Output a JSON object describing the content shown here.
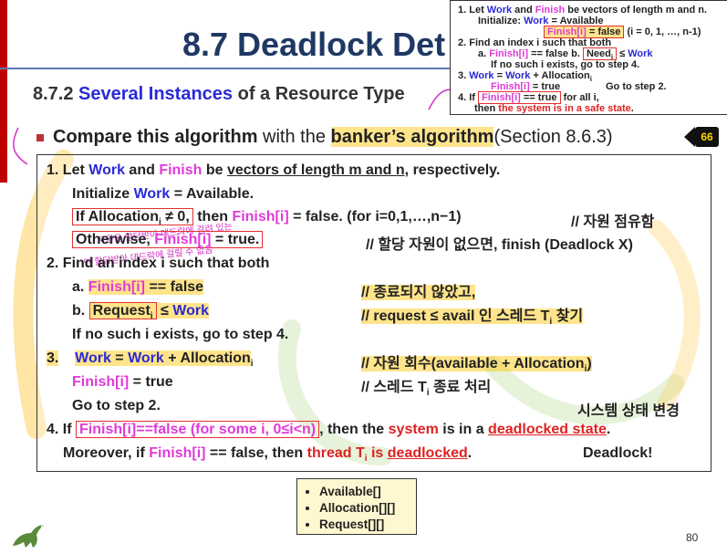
{
  "title": "8.7 Deadlock Det",
  "subtitle": {
    "prefix": "8.7.2 ",
    "highlight": "Several Instances",
    "suffix": " of a Resource Type"
  },
  "bullet": {
    "bold": "Compare this algorithm",
    "middle": " with the ",
    "banker": "banker’s algorithm",
    "section": "(Section 8.6.3)",
    "badge": "66"
  },
  "main": {
    "l1": {
      "num": "1.",
      "a": "Let ",
      "work": "Work",
      "b": " and ",
      "finish": "Finish",
      "c": " be ",
      "d": "vectors of length m and n",
      "e": ", respectively."
    },
    "l2": {
      "a": "Initialize ",
      "work": "Work",
      "b": " = Available."
    },
    "l3": {
      "a": "If  Allocation",
      "sub": "i",
      "b": " ≠ 0,",
      "c": " then ",
      "finish": "Finish[i]",
      "d": " = false.  (for i=0,1,…,n−1)",
      "comment": "// 자원 점유함"
    },
    "l4": {
      "a": "Otherwise, ",
      "finish": "Finish[i]",
      "b": " = true.",
      "comment": "// 할당 자원이 없으면, finish (Deadlock X)"
    },
    "l5": {
      "text": "2. Find an index i such that both"
    },
    "l6": {
      "a": "a.  ",
      "finish": "Finish[i]",
      "b": " == false",
      "comment": "// 종료되지 않았고,"
    },
    "l7": {
      "a": "b.  ",
      "req": "Request",
      "sub": "i",
      "b": " ≤ ",
      "work": "Work",
      "comment": "// request  ≤  avail 인 스레드 T",
      "csub": "i",
      "cend": " 찾기"
    },
    "l8": {
      "text": "If  no such i exists,  go to step 4."
    },
    "l9": {
      "num": "3.",
      "work": "Work",
      "b": " = ",
      "work2": "Work",
      "c": " + Allocation",
      "sub": "i",
      "comment": "// 자원 회수(available + Allocation",
      "csub": "i",
      "cend": ")"
    },
    "l10": {
      "finish": "Finish[i]",
      "b": " = true",
      "comment": "// 스레드 T",
      "csub": "i",
      "cend": " 종료 처리"
    },
    "l11": {
      "text": "Go to step 2.",
      "note": "시스템 상태 변경"
    },
    "l12": {
      "a": "4. If ",
      "finish": "Finish[i]==false (for some i, 0≤i<n)",
      "b": ",  then the ",
      "sys": "system",
      "c": " is in a ",
      "dead": "deadlocked state",
      "d": "."
    },
    "l13": {
      "a": "Moreover, if ",
      "finish": "Finish[i]",
      "b": " == false,  then ",
      "thread": "thread T",
      "tsub": "i",
      "c": " is ",
      "dl": "deadlocked",
      "d": ".",
      "note": "Deadlock!"
    },
    "hand1": "자원을 할당받아 데드락에 걸려 있는",
    "hand2": "안 할당받아 데드락에 걸릴 수 없음"
  },
  "topbox": {
    "t1": {
      "a": "1. Let ",
      "work": "Work",
      "b": " and ",
      "finish": "Finish",
      "c": " be vectors of length m and n."
    },
    "t2": {
      "a": "Initialize:  ",
      "work": "Work",
      "b": " = Available"
    },
    "t3": {
      "finish": "Finish[i]",
      "b": " = false",
      "c": "  (i = 0, 1, …, n-1)"
    },
    "t4": {
      "text": "2. Find an index i such that both"
    },
    "t5": {
      "a": "a. ",
      "finish": "Finish[i]",
      "b": " == false",
      "c": "      b. ",
      "need": "Need",
      "sub": "i",
      "d": " ≤ ",
      "work": "Work"
    },
    "t6": {
      "text": "If no such i exists,  go to step 4."
    },
    "t7": {
      "a": "3. ",
      "work": "Work",
      "b": " = ",
      "work2": "Work",
      "c": " + Allocation",
      "sub": "i"
    },
    "t8": {
      "finish": "Finish[i]",
      "b": " = true",
      "c": "Go to step 2."
    },
    "t9": {
      "a": "4. If ",
      "finish": "Finish[i]",
      "b": " == true",
      "c": "  for all i,"
    },
    "t10": {
      "a": "then ",
      "sys": "the system is in a safe state",
      "b": "."
    }
  },
  "lowbox": [
    "Available[]",
    "Allocation[][]",
    "Request[][]"
  ],
  "page_number": "80",
  "colors": {
    "title": "#1f3864",
    "work": "#2a2ad6",
    "finish": "#e03ad8",
    "alert": "#d22222",
    "comment": "#1e7a24",
    "highlight": "#ffc400"
  }
}
